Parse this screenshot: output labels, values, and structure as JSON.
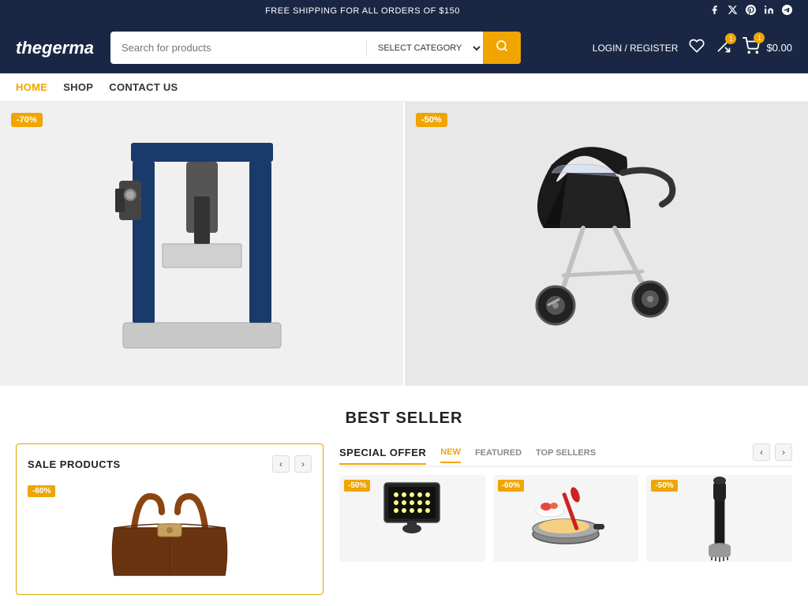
{
  "topBanner": {
    "text": "FREE SHIPPING FOR ALL ORDERS OF $150",
    "social": [
      {
        "name": "facebook",
        "icon": "f"
      },
      {
        "name": "twitter-x",
        "icon": "✕"
      },
      {
        "name": "pinterest",
        "icon": "p"
      },
      {
        "name": "linkedin",
        "icon": "in"
      },
      {
        "name": "telegram",
        "icon": "t"
      }
    ]
  },
  "header": {
    "logo": "thegerma",
    "search": {
      "placeholder": "Search for products",
      "category_label": "SELECT CATEGORY"
    },
    "loginLabel": "LOGIN / REGISTER",
    "wishlistBadge": "",
    "compareBadge": "1",
    "cartBadge": "1",
    "cartPrice": "$0.00"
  },
  "nav": {
    "items": [
      {
        "label": "HOME",
        "active": true
      },
      {
        "label": "SHOP",
        "active": false
      },
      {
        "label": "CONTACT US",
        "active": false
      }
    ]
  },
  "hero": {
    "left": {
      "badge": "-70%",
      "altText": "Industrial Press Machine"
    },
    "right": {
      "badge": "-50%",
      "altText": "Baby Stroller"
    }
  },
  "bestSeller": {
    "title": "BEST SELLER"
  },
  "saleProducts": {
    "title": "SALE PRODUCTS",
    "badge": "-60%"
  },
  "specialOffer": {
    "title": "SPECIAL OFFER",
    "tabs": [
      {
        "label": "NEW",
        "active": true
      },
      {
        "label": "FEATURED",
        "active": false
      },
      {
        "label": "TOP SELLERS",
        "active": false
      }
    ],
    "products": [
      {
        "badge": "-50%",
        "alt": "Solar Light"
      },
      {
        "badge": "-60%",
        "alt": "Food Processor"
      },
      {
        "badge": "-50%",
        "alt": "Cleaning Tool"
      }
    ]
  }
}
